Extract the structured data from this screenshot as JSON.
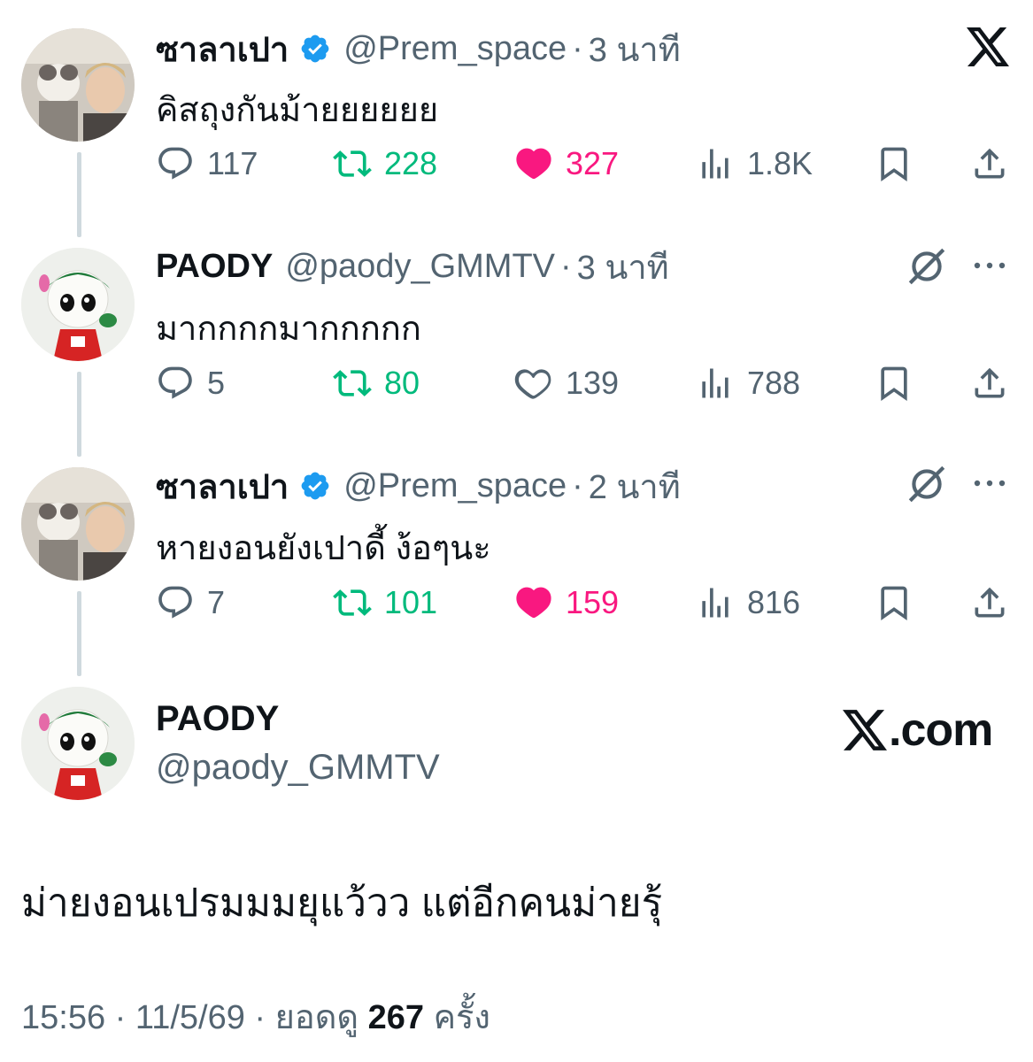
{
  "brand": {
    "x_logo": "x-logo-icon",
    "site": ".com"
  },
  "tweets": [
    {
      "name": "ซาลาเปา",
      "verified": true,
      "handle": "@Prem_space",
      "sep": "·",
      "time": "3 นาที",
      "text": "คิสถุงกันม้ายยยยยย",
      "replies": "117",
      "retweets": "228",
      "likes": "327",
      "liked": true,
      "views": "1.8K"
    },
    {
      "name": "PAODY",
      "verified": false,
      "handle": "@paody_GMMTV",
      "sep": "·",
      "time": "3 นาที",
      "text": "มากกกกมากกกกก",
      "replies": "5",
      "retweets": "80",
      "likes": "139",
      "liked": false,
      "views": "788"
    },
    {
      "name": "ซาลาเปา",
      "verified": true,
      "handle": "@Prem_space",
      "sep": "·",
      "time": "2 นาที",
      "text": "หายงอนยังเปาดี้ ง้อๆนะ",
      "replies": "7",
      "retweets": "101",
      "likes": "159",
      "liked": true,
      "views": "816"
    }
  ],
  "main": {
    "name": "PAODY",
    "handle": "@paody_GMMTV",
    "text": "ม่ายงอนเปรมมมยุแว้วว แต่อีกคนม่ายรุ้",
    "time": "15:56",
    "date": "11/5/69",
    "views_prefix": "· ยอดดู",
    "views": "267",
    "views_suffix": "ครั้ง",
    "sep": "·"
  },
  "colors": {
    "verified": "#1d9bf0",
    "retweet": "#00ba7c",
    "like": "#f91880",
    "muted": "#536471"
  }
}
